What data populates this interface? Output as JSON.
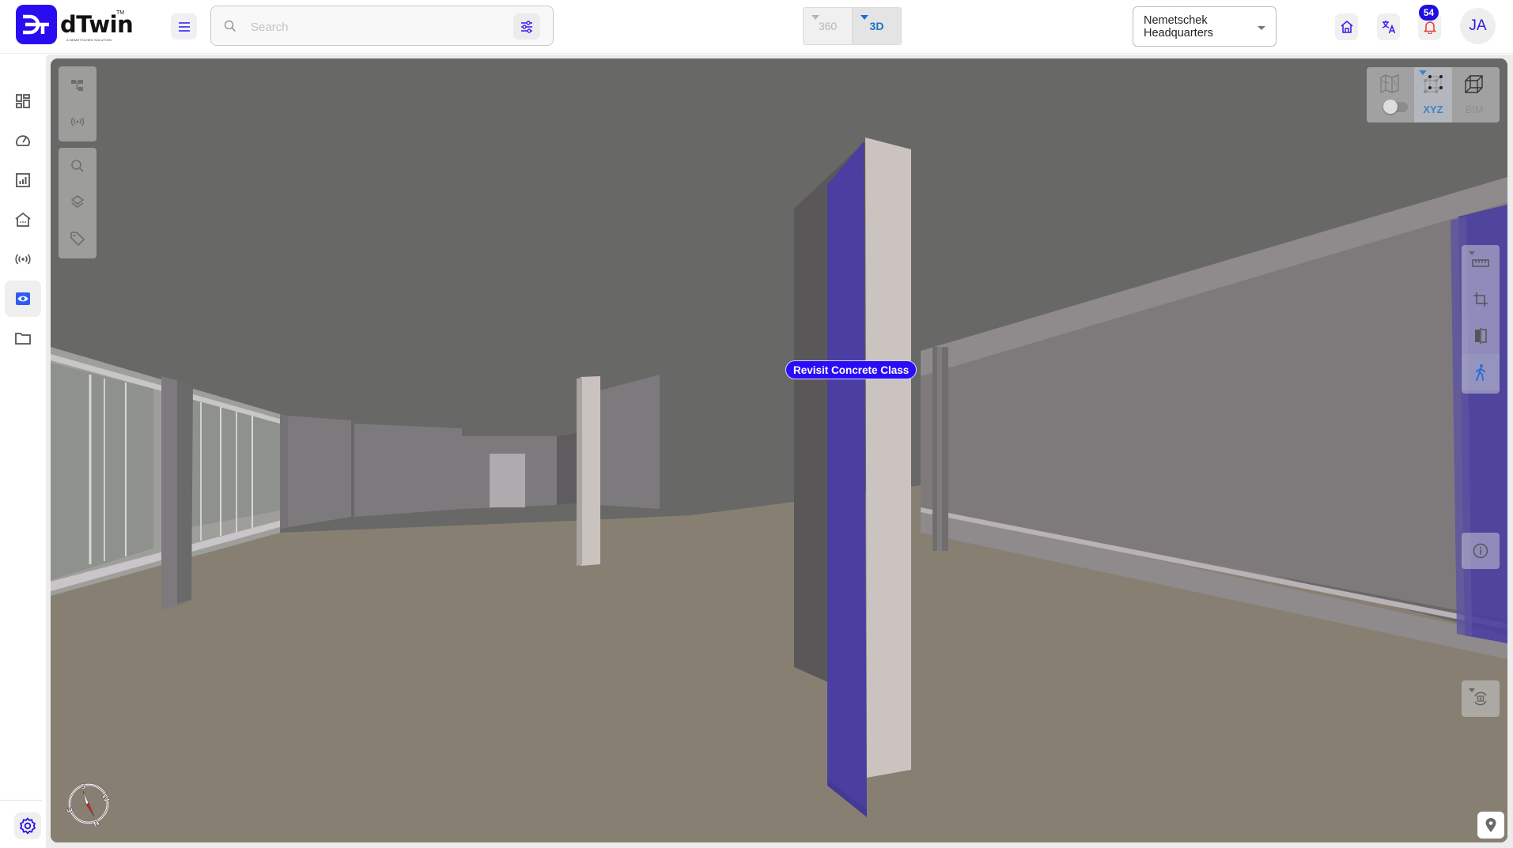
{
  "app": {
    "logo_text": "dTwin",
    "logo_tm": "TM",
    "logo_tagline": "A NEMETSCHEK SOLUTION"
  },
  "header": {
    "menu_icon": "hamburger-menu-icon",
    "search": {
      "placeholder": "Search",
      "value": "",
      "icon": "search-icon",
      "filter_icon": "sliders-icon"
    },
    "view_modes": [
      {
        "label": "360",
        "active": false
      },
      {
        "label": "3D",
        "active": true
      }
    ],
    "site_selector": {
      "value": "Nemetschek Headquarters"
    },
    "actions": [
      {
        "name": "home",
        "icon": "home-icon"
      },
      {
        "name": "translate",
        "icon": "translate-icon"
      },
      {
        "name": "notifications",
        "icon": "bell-icon",
        "badge": "54"
      }
    ],
    "user_initials": "JA"
  },
  "sidebar": {
    "items": [
      {
        "name": "dashboard",
        "icon": "dashboard-icon",
        "active": false
      },
      {
        "name": "performance",
        "icon": "gauge-icon",
        "active": false
      },
      {
        "name": "reports",
        "icon": "bar-chart-icon",
        "active": false
      },
      {
        "name": "buildings",
        "icon": "house-icon",
        "active": false
      },
      {
        "name": "sensors",
        "icon": "sensor-icon",
        "active": false
      },
      {
        "name": "viewer",
        "icon": "eye-icon",
        "active": true
      },
      {
        "name": "files",
        "icon": "folder-icon",
        "active": false
      }
    ],
    "settings_icon": "gear-icon"
  },
  "viewer": {
    "left_tools": [
      {
        "group": 1,
        "items": [
          "hierarchy-icon",
          "sensor-icon"
        ]
      },
      {
        "group": 2,
        "items": [
          "search-icon",
          "layers-icon",
          "tag-icon"
        ]
      }
    ],
    "view_switch": [
      {
        "name": "map",
        "label": "",
        "icon": "map-icon",
        "toggle_on": false
      },
      {
        "name": "xyz",
        "label": "XYZ",
        "icon": "point-cloud-icon",
        "active": true
      },
      {
        "name": "bim",
        "label": "BIM",
        "icon": "cube-icon",
        "active": false
      }
    ],
    "right_tools": [
      "ruler-icon",
      "crop-icon",
      "compare-icon",
      "walk-icon"
    ],
    "info_icon": "info-icon",
    "camera_icon": "rotate-camera-icon",
    "location_icon": "map-pin-icon",
    "compass": {
      "labels": [
        "S",
        "W",
        "N",
        "E"
      ]
    },
    "issue_tag": {
      "label": "Revisit Concrete Class",
      "color": "#2a0cf5"
    },
    "colors": {
      "accent": "#2a0cf0",
      "highlight": "#4a3fa0",
      "ceiling": "#686866",
      "floor": "#878072"
    }
  }
}
